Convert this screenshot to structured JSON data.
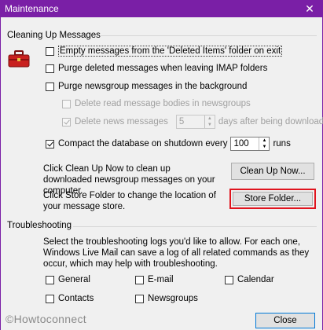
{
  "window": {
    "title": "Maintenance",
    "close_glyph": "✕"
  },
  "cleanup_group": {
    "label": "Cleaning Up Messages",
    "icon": "toolbox-icon",
    "options": {
      "empty_deleted": "Empty messages from the 'Deleted Items' folder on exit",
      "purge_imap": "Purge deleted messages when leaving IMAP folders",
      "purge_newsgroup": "Purge newsgroup messages in the background",
      "delete_read_bodies": "Delete read message bodies in newsgroups",
      "delete_news_prefix": "Delete news messages",
      "delete_news_days": "5",
      "delete_news_suffix": "days after being downloaded",
      "compact_prefix": "Compact the database on shutdown every",
      "compact_runs": "100",
      "compact_suffix": "runs"
    },
    "cleanup_text": "Click Clean Up Now to clean up downloaded newsgroup messages on your computer.",
    "cleanup_button": "Clean Up Now...",
    "store_text": "Click Store Folder to change the location of your message store.",
    "store_button": "Store Folder..."
  },
  "troubleshooting_group": {
    "label": "Troubleshooting",
    "description": "Select the troubleshooting logs you'd like to allow. For each one, Windows Live Mail can save a log of all related commands as they occur, which may help with troubleshooting.",
    "logs": {
      "general": "General",
      "email": "E-mail",
      "calendar": "Calendar",
      "contacts": "Contacts",
      "newsgroups": "Newsgroups"
    }
  },
  "close_button": "Close",
  "watermark": "©Howtoconnect"
}
